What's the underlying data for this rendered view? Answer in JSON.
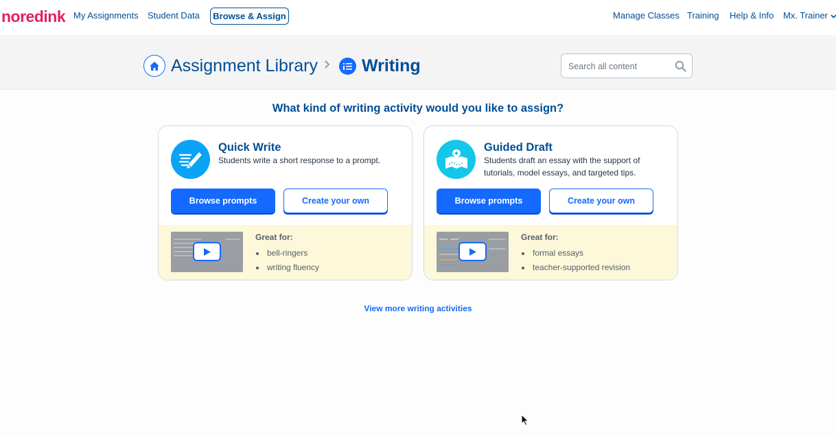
{
  "nav": {
    "logo": {
      "part1": "no",
      "part2": "red",
      "part3": "ink"
    },
    "left_links": [
      "My Assignments",
      "Student Data"
    ],
    "active_link": "Browse & Assign",
    "right_links": [
      "Manage Classes",
      "Training",
      "Help & Info"
    ],
    "user_menu": "Mx. Trainer"
  },
  "header": {
    "breadcrumb_root": "Assignment Library",
    "breadcrumb_separator": "›",
    "breadcrumb_current": "Writing",
    "search_placeholder": "Search all content"
  },
  "main": {
    "question": "What kind of writing activity would you like to assign?",
    "cards": [
      {
        "title": "Quick Write",
        "description": "Students write a short response to a prompt.",
        "icon": "pencil-lines-icon",
        "primary_button": "Browse prompts",
        "secondary_button": "Create your own",
        "great_for_label": "Great for:",
        "great_for": [
          "bell-ringers",
          "writing fluency"
        ]
      },
      {
        "title": "Guided Draft",
        "description": "Students draft an essay with the support of tutorials, model essays, and targeted tips.",
        "icon": "map-route-icon",
        "primary_button": "Browse prompts",
        "secondary_button": "Create your own",
        "great_for_label": "Great for:",
        "great_for": [
          "formal essays",
          "teacher-supported revision"
        ]
      }
    ],
    "more_link": "View more writing activities"
  },
  "colors": {
    "brand_red": "#e3205b",
    "navy": "#004e95",
    "primary_blue": "#146aff",
    "quick_write_icon_bg": "#0aa3f5",
    "guided_draft_icon_bg": "#14c7e9",
    "footer_yellow": "#fdf8d9"
  }
}
